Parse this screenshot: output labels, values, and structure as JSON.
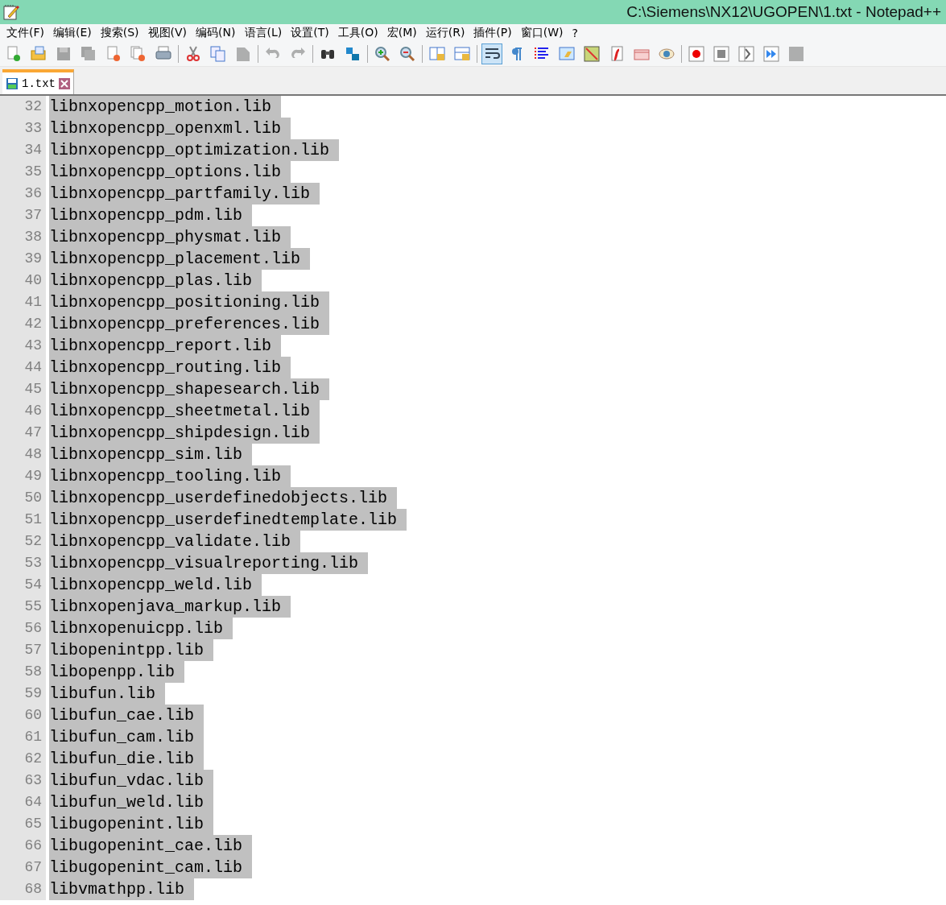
{
  "window": {
    "title": "C:\\Siemens\\NX12\\UGOPEN\\1.txt - Notepad++"
  },
  "menu": [
    "文件(F)",
    "编辑(E)",
    "搜索(S)",
    "视图(V)",
    "编码(N)",
    "语言(L)",
    "设置(T)",
    "工具(O)",
    "宏(M)",
    "运行(R)",
    "插件(P)",
    "窗口(W)",
    "?"
  ],
  "toolbar": [
    {
      "kind": "new",
      "disabled": false,
      "on": false
    },
    {
      "kind": "open",
      "disabled": false,
      "on": false
    },
    {
      "kind": "save",
      "disabled": true,
      "on": false
    },
    {
      "kind": "saveall",
      "disabled": true,
      "on": false
    },
    {
      "kind": "close",
      "disabled": false,
      "on": false
    },
    {
      "kind": "closeall",
      "disabled": false,
      "on": false
    },
    {
      "kind": "print",
      "disabled": false,
      "on": false
    },
    {
      "kind": "separator"
    },
    {
      "kind": "cut",
      "disabled": false,
      "on": false
    },
    {
      "kind": "copy",
      "disabled": false,
      "on": false
    },
    {
      "kind": "paste",
      "disabled": true,
      "on": false
    },
    {
      "kind": "separator"
    },
    {
      "kind": "undo",
      "disabled": true,
      "on": false
    },
    {
      "kind": "redo",
      "disabled": true,
      "on": false
    },
    {
      "kind": "separator"
    },
    {
      "kind": "find",
      "disabled": false,
      "on": false
    },
    {
      "kind": "replace",
      "disabled": false,
      "on": false
    },
    {
      "kind": "separator"
    },
    {
      "kind": "zoomin",
      "disabled": false,
      "on": false
    },
    {
      "kind": "zoomout",
      "disabled": false,
      "on": false
    },
    {
      "kind": "separator"
    },
    {
      "kind": "lockv",
      "disabled": false,
      "on": false
    },
    {
      "kind": "lockh",
      "disabled": false,
      "on": false
    },
    {
      "kind": "separator"
    },
    {
      "kind": "wrap",
      "disabled": false,
      "on": true
    },
    {
      "kind": "pilcrow",
      "disabled": false,
      "on": false
    },
    {
      "kind": "indent",
      "disabled": false,
      "on": false
    },
    {
      "kind": "window",
      "disabled": false,
      "on": false
    },
    {
      "kind": "map",
      "disabled": false,
      "on": false
    },
    {
      "kind": "function",
      "disabled": false,
      "on": false
    },
    {
      "kind": "folder",
      "disabled": false,
      "on": false
    },
    {
      "kind": "eye",
      "disabled": false,
      "on": false
    },
    {
      "kind": "separator"
    },
    {
      "kind": "record",
      "disabled": false,
      "on": false
    },
    {
      "kind": "stop",
      "disabled": false,
      "on": false
    },
    {
      "kind": "play",
      "disabled": false,
      "on": false
    },
    {
      "kind": "playmulti",
      "disabled": false,
      "on": false
    },
    {
      "kind": "savemacro",
      "disabled": true,
      "on": false
    }
  ],
  "tabs": [
    {
      "label": "1.txt",
      "selected": true
    }
  ],
  "lines": [
    {
      "number": "32",
      "text": "libnxopencpp_motion.lib",
      "selected": true
    },
    {
      "number": "33",
      "text": "libnxopencpp_openxml.lib",
      "selected": true
    },
    {
      "number": "34",
      "text": "libnxopencpp_optimization.lib",
      "selected": true
    },
    {
      "number": "35",
      "text": "libnxopencpp_options.lib",
      "selected": true
    },
    {
      "number": "36",
      "text": "libnxopencpp_partfamily.lib",
      "selected": true
    },
    {
      "number": "37",
      "text": "libnxopencpp_pdm.lib",
      "selected": true
    },
    {
      "number": "38",
      "text": "libnxopencpp_physmat.lib",
      "selected": true
    },
    {
      "number": "39",
      "text": "libnxopencpp_placement.lib",
      "selected": true
    },
    {
      "number": "40",
      "text": "libnxopencpp_plas.lib",
      "selected": true
    },
    {
      "number": "41",
      "text": "libnxopencpp_positioning.lib",
      "selected": true
    },
    {
      "number": "42",
      "text": "libnxopencpp_preferences.lib",
      "selected": true
    },
    {
      "number": "43",
      "text": "libnxopencpp_report.lib",
      "selected": true
    },
    {
      "number": "44",
      "text": "libnxopencpp_routing.lib",
      "selected": true
    },
    {
      "number": "45",
      "text": "libnxopencpp_shapesearch.lib",
      "selected": true
    },
    {
      "number": "46",
      "text": "libnxopencpp_sheetmetal.lib",
      "selected": true
    },
    {
      "number": "47",
      "text": "libnxopencpp_shipdesign.lib",
      "selected": true
    },
    {
      "number": "48",
      "text": "libnxopencpp_sim.lib",
      "selected": true
    },
    {
      "number": "49",
      "text": "libnxopencpp_tooling.lib",
      "selected": true
    },
    {
      "number": "50",
      "text": "libnxopencpp_userdefinedobjects.lib",
      "selected": true
    },
    {
      "number": "51",
      "text": "libnxopencpp_userdefinedtemplate.lib",
      "selected": true
    },
    {
      "number": "52",
      "text": "libnxopencpp_validate.lib",
      "selected": true
    },
    {
      "number": "53",
      "text": "libnxopencpp_visualreporting.lib",
      "selected": true
    },
    {
      "number": "54",
      "text": "libnxopencpp_weld.lib",
      "selected": true
    },
    {
      "number": "55",
      "text": "libnxopenjava_markup.lib",
      "selected": true
    },
    {
      "number": "56",
      "text": "libnxopenuicpp.lib",
      "selected": true
    },
    {
      "number": "57",
      "text": "libopenintpp.lib",
      "selected": true
    },
    {
      "number": "58",
      "text": "libopenpp.lib",
      "selected": true
    },
    {
      "number": "59",
      "text": "libufun.lib",
      "selected": true
    },
    {
      "number": "60",
      "text": "libufun_cae.lib",
      "selected": true
    },
    {
      "number": "61",
      "text": "libufun_cam.lib",
      "selected": true
    },
    {
      "number": "62",
      "text": "libufun_die.lib",
      "selected": true
    },
    {
      "number": "63",
      "text": "libufun_vdac.lib",
      "selected": true
    },
    {
      "number": "64",
      "text": "libufun_weld.lib",
      "selected": true
    },
    {
      "number": "65",
      "text": "libugopenint.lib",
      "selected": true
    },
    {
      "number": "66",
      "text": "libugopenint_cae.lib",
      "selected": true
    },
    {
      "number": "67",
      "text": "libugopenint_cam.lib",
      "selected": true
    },
    {
      "number": "68",
      "text": "libvmathpp.lib",
      "selected": true
    }
  ]
}
